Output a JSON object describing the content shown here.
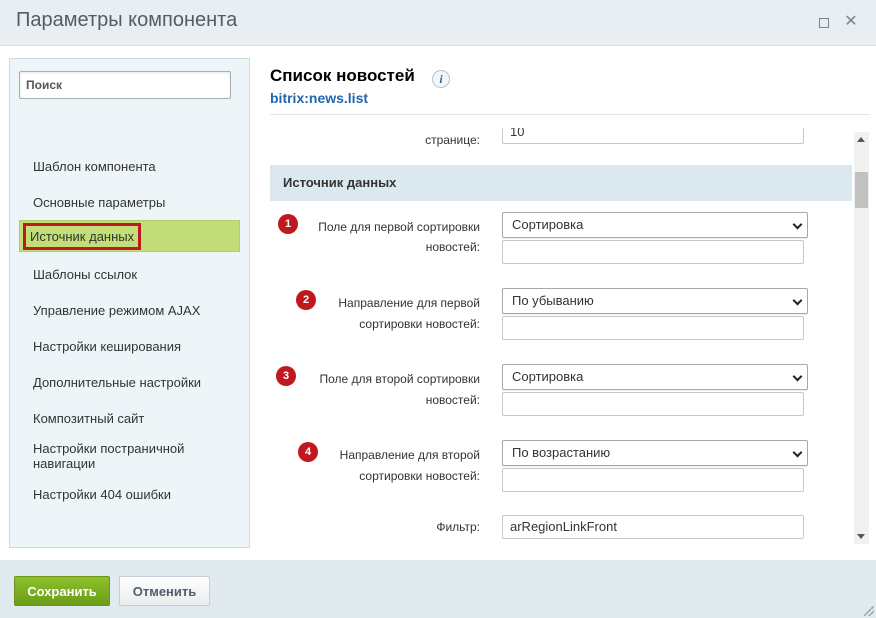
{
  "dialog": {
    "title": "Параметры компонента"
  },
  "sidebar": {
    "search_placeholder": "Поиск",
    "items": [
      {
        "label": "Шаблон компонента"
      },
      {
        "label": "Основные параметры"
      },
      {
        "label": "Источник данных",
        "active": true
      },
      {
        "label": "Шаблоны ссылок"
      },
      {
        "label": "Управление режимом AJAX"
      },
      {
        "label": "Настройки кеширования"
      },
      {
        "label": "Дополнительные настройки"
      },
      {
        "label": "Композитный сайт"
      },
      {
        "label": "Настройки постраничной навигации"
      },
      {
        "label": "Настройки 404 ошибки"
      }
    ]
  },
  "component": {
    "title": "Список новостей",
    "info_icon": "i",
    "code": "bitrix:news.list"
  },
  "form": {
    "top_partial": {
      "label": "странице:",
      "value": "10"
    },
    "section_title": "Источник данных",
    "fields": [
      {
        "badge": "1",
        "label_line1": "Поле для первой сортировки",
        "label_line2": "новостей:",
        "select_value": "Сортировка"
      },
      {
        "badge": "2",
        "label_line1": "Направление для первой",
        "label_line2": "сортировки новостей:",
        "select_value": "По убыванию"
      },
      {
        "badge": "3",
        "label_line1": "Поле для второй сортировки",
        "label_line2": "новостей:",
        "select_value": "Сортировка"
      },
      {
        "badge": "4",
        "label_line1": "Направление для второй",
        "label_line2": "сортировки новостей:",
        "select_value": "По возрастанию"
      }
    ],
    "filter": {
      "label": "Фильтр:",
      "value": "arRegionLinkFront"
    }
  },
  "footer": {
    "save_label": "Сохранить",
    "cancel_label": "Отменить"
  },
  "colors": {
    "accent_green": "#6b9d16",
    "active_item": "#c3dd79",
    "badge_red": "#c0181f",
    "link_blue": "#2067b0",
    "section_bg": "#dce8f0"
  },
  "icons": {
    "maximize": "maximize-icon",
    "close": "close-icon",
    "info": "info-icon",
    "dropdown": "chevron-down-icon"
  }
}
